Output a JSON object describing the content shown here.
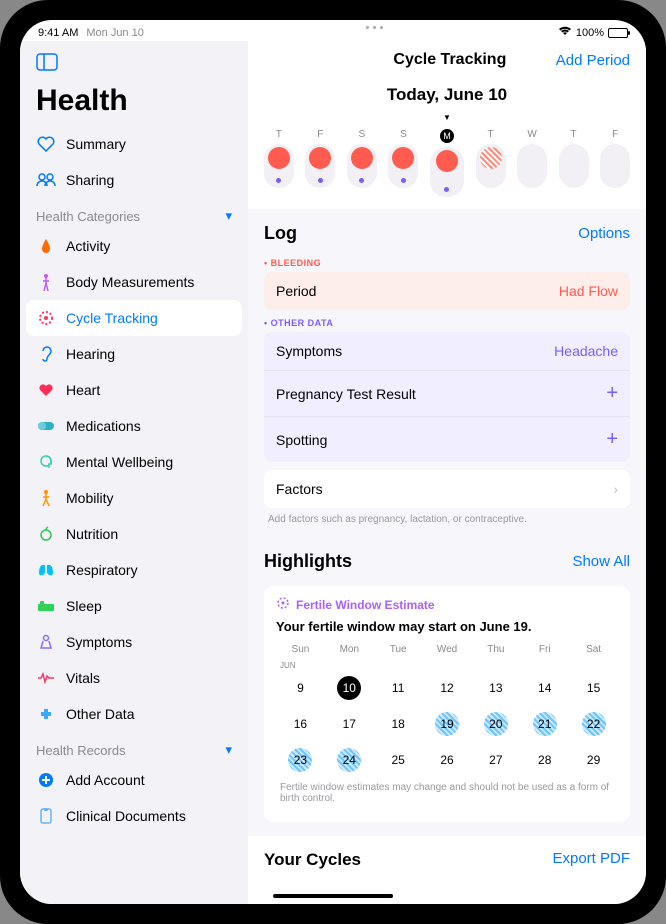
{
  "status": {
    "time": "9:41 AM",
    "date": "Mon Jun 10",
    "battery": "100%"
  },
  "sidebar": {
    "title": "Health",
    "top": [
      {
        "label": "Summary"
      },
      {
        "label": "Sharing"
      }
    ],
    "categories_header": "Health Categories",
    "categories": [
      {
        "label": "Activity"
      },
      {
        "label": "Body Measurements"
      },
      {
        "label": "Cycle Tracking"
      },
      {
        "label": "Hearing"
      },
      {
        "label": "Heart"
      },
      {
        "label": "Medications"
      },
      {
        "label": "Mental Wellbeing"
      },
      {
        "label": "Mobility"
      },
      {
        "label": "Nutrition"
      },
      {
        "label": "Respiratory"
      },
      {
        "label": "Sleep"
      },
      {
        "label": "Symptoms"
      },
      {
        "label": "Vitals"
      },
      {
        "label": "Other Data"
      }
    ],
    "records_header": "Health Records",
    "records": [
      {
        "label": "Add Account"
      },
      {
        "label": "Clinical Documents"
      }
    ]
  },
  "main": {
    "title": "Cycle Tracking",
    "add_period": "Add Period",
    "today_label": "Today, June 10",
    "days": [
      {
        "letter": "T",
        "period": "full",
        "indicator": true
      },
      {
        "letter": "F",
        "period": "full",
        "indicator": true
      },
      {
        "letter": "S",
        "period": "full",
        "indicator": true
      },
      {
        "letter": "S",
        "period": "full",
        "indicator": true
      },
      {
        "letter": "M",
        "period": "full",
        "indicator": true,
        "today": true
      },
      {
        "letter": "T",
        "period": "hatched",
        "indicator": false
      },
      {
        "letter": "W",
        "period": "",
        "indicator": false
      },
      {
        "letter": "T",
        "period": "",
        "indicator": false
      },
      {
        "letter": "F",
        "period": "",
        "indicator": false
      }
    ],
    "log": {
      "title": "Log",
      "options": "Options",
      "bleeding_label": "BLEEDING",
      "bleeding": [
        {
          "name": "Period",
          "value": "Had Flow"
        }
      ],
      "other_label": "OTHER DATA",
      "other": [
        {
          "name": "Symptoms",
          "value": "Headache"
        },
        {
          "name": "Pregnancy Test Result",
          "value": "+"
        },
        {
          "name": "Spotting",
          "value": "+"
        }
      ],
      "factors": "Factors",
      "factors_hint": "Add factors such as pregnancy, lactation, or contraceptive."
    },
    "highlights": {
      "title": "Highlights",
      "show_all": "Show All",
      "badge": "Fertile Window Estimate",
      "text": "Your fertile window may start on June 19.",
      "weekdays": [
        "Sun",
        "Mon",
        "Tue",
        "Wed",
        "Thu",
        "Fri",
        "Sat"
      ],
      "month": "JUN",
      "rows": [
        [
          {
            "n": 9
          },
          {
            "n": 10,
            "today": true
          },
          {
            "n": 11
          },
          {
            "n": 12
          },
          {
            "n": 13
          },
          {
            "n": 14
          },
          {
            "n": 15
          }
        ],
        [
          {
            "n": 16
          },
          {
            "n": 17
          },
          {
            "n": 18
          },
          {
            "n": 19,
            "fertile": true
          },
          {
            "n": 20,
            "fertile": true
          },
          {
            "n": 21,
            "fertile": true
          },
          {
            "n": 22,
            "fertile": true
          }
        ],
        [
          {
            "n": 23,
            "fertile": true
          },
          {
            "n": 24,
            "fertile": true
          },
          {
            "n": 25
          },
          {
            "n": 26
          },
          {
            "n": 27
          },
          {
            "n": 28
          },
          {
            "n": 29
          }
        ]
      ],
      "disclaimer": "Fertile window estimates may change and should not be used as a form of birth control."
    },
    "cycles": {
      "title": "Your Cycles",
      "export": "Export PDF"
    }
  }
}
